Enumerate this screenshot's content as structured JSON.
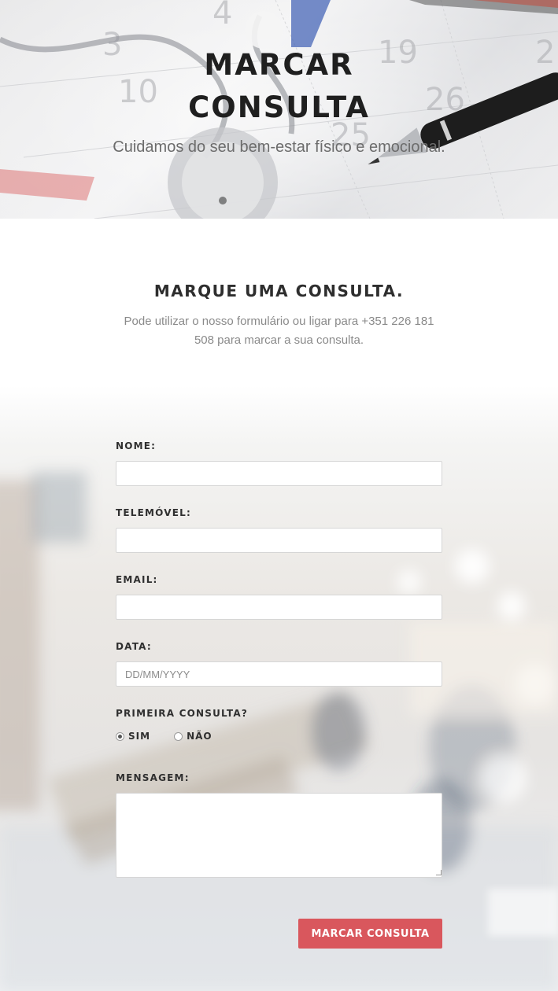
{
  "hero": {
    "title_line1": "MARCAR",
    "title_line2": "CONSULTA",
    "subtitle": "Cuidamos do seu bem-estar físico e emocional."
  },
  "intro": {
    "heading": "MARQUE UMA CONSULTA.",
    "text": "Pode utilizar o nosso formulário ou ligar para +351 226 181 508 para marcar a sua consulta."
  },
  "form": {
    "name_label": "NOME:",
    "name_value": "",
    "phone_label": "TELEMÓVEL:",
    "phone_value": "",
    "email_label": "EMAIL:",
    "email_value": "",
    "date_label": "DATA:",
    "date_placeholder": "DD/MM/YYYY",
    "first_visit_label": "PRIMEIRA CONSULTA?",
    "first_visit_options": [
      {
        "label": "SIM",
        "checked": true
      },
      {
        "label": "NÃO",
        "checked": false
      }
    ],
    "message_label": "MENSAGEM:",
    "message_value": "",
    "submit_label": "MARCAR CONSULTA"
  },
  "colors": {
    "accent": "#d9575d",
    "heading": "#2e2e2e",
    "muted_text": "#8a8a8a"
  },
  "icons": {
    "radio_checked": "radio-checked-icon",
    "radio_unchecked": "radio-unchecked-icon",
    "resize": "resize-grip-icon"
  }
}
